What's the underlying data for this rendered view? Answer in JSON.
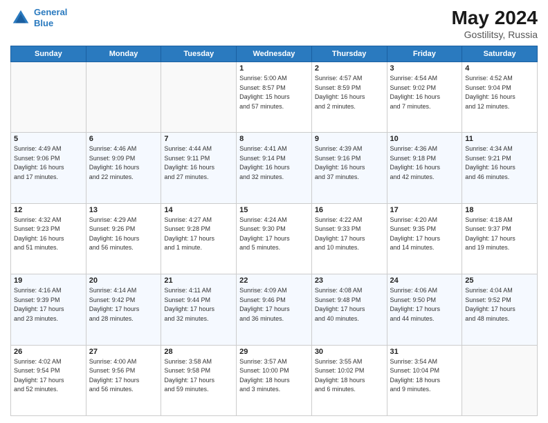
{
  "header": {
    "logo_line1": "General",
    "logo_line2": "Blue",
    "month": "May 2024",
    "location": "Gostilitsy, Russia"
  },
  "weekdays": [
    "Sunday",
    "Monday",
    "Tuesday",
    "Wednesday",
    "Thursday",
    "Friday",
    "Saturday"
  ],
  "weeks": [
    [
      {
        "day": "",
        "info": ""
      },
      {
        "day": "",
        "info": ""
      },
      {
        "day": "",
        "info": ""
      },
      {
        "day": "1",
        "info": "Sunrise: 5:00 AM\nSunset: 8:57 PM\nDaylight: 15 hours\nand 57 minutes."
      },
      {
        "day": "2",
        "info": "Sunrise: 4:57 AM\nSunset: 8:59 PM\nDaylight: 16 hours\nand 2 minutes."
      },
      {
        "day": "3",
        "info": "Sunrise: 4:54 AM\nSunset: 9:02 PM\nDaylight: 16 hours\nand 7 minutes."
      },
      {
        "day": "4",
        "info": "Sunrise: 4:52 AM\nSunset: 9:04 PM\nDaylight: 16 hours\nand 12 minutes."
      }
    ],
    [
      {
        "day": "5",
        "info": "Sunrise: 4:49 AM\nSunset: 9:06 PM\nDaylight: 16 hours\nand 17 minutes."
      },
      {
        "day": "6",
        "info": "Sunrise: 4:46 AM\nSunset: 9:09 PM\nDaylight: 16 hours\nand 22 minutes."
      },
      {
        "day": "7",
        "info": "Sunrise: 4:44 AM\nSunset: 9:11 PM\nDaylight: 16 hours\nand 27 minutes."
      },
      {
        "day": "8",
        "info": "Sunrise: 4:41 AM\nSunset: 9:14 PM\nDaylight: 16 hours\nand 32 minutes."
      },
      {
        "day": "9",
        "info": "Sunrise: 4:39 AM\nSunset: 9:16 PM\nDaylight: 16 hours\nand 37 minutes."
      },
      {
        "day": "10",
        "info": "Sunrise: 4:36 AM\nSunset: 9:18 PM\nDaylight: 16 hours\nand 42 minutes."
      },
      {
        "day": "11",
        "info": "Sunrise: 4:34 AM\nSunset: 9:21 PM\nDaylight: 16 hours\nand 46 minutes."
      }
    ],
    [
      {
        "day": "12",
        "info": "Sunrise: 4:32 AM\nSunset: 9:23 PM\nDaylight: 16 hours\nand 51 minutes."
      },
      {
        "day": "13",
        "info": "Sunrise: 4:29 AM\nSunset: 9:26 PM\nDaylight: 16 hours\nand 56 minutes."
      },
      {
        "day": "14",
        "info": "Sunrise: 4:27 AM\nSunset: 9:28 PM\nDaylight: 17 hours\nand 1 minute."
      },
      {
        "day": "15",
        "info": "Sunrise: 4:24 AM\nSunset: 9:30 PM\nDaylight: 17 hours\nand 5 minutes."
      },
      {
        "day": "16",
        "info": "Sunrise: 4:22 AM\nSunset: 9:33 PM\nDaylight: 17 hours\nand 10 minutes."
      },
      {
        "day": "17",
        "info": "Sunrise: 4:20 AM\nSunset: 9:35 PM\nDaylight: 17 hours\nand 14 minutes."
      },
      {
        "day": "18",
        "info": "Sunrise: 4:18 AM\nSunset: 9:37 PM\nDaylight: 17 hours\nand 19 minutes."
      }
    ],
    [
      {
        "day": "19",
        "info": "Sunrise: 4:16 AM\nSunset: 9:39 PM\nDaylight: 17 hours\nand 23 minutes."
      },
      {
        "day": "20",
        "info": "Sunrise: 4:14 AM\nSunset: 9:42 PM\nDaylight: 17 hours\nand 28 minutes."
      },
      {
        "day": "21",
        "info": "Sunrise: 4:11 AM\nSunset: 9:44 PM\nDaylight: 17 hours\nand 32 minutes."
      },
      {
        "day": "22",
        "info": "Sunrise: 4:09 AM\nSunset: 9:46 PM\nDaylight: 17 hours\nand 36 minutes."
      },
      {
        "day": "23",
        "info": "Sunrise: 4:08 AM\nSunset: 9:48 PM\nDaylight: 17 hours\nand 40 minutes."
      },
      {
        "day": "24",
        "info": "Sunrise: 4:06 AM\nSunset: 9:50 PM\nDaylight: 17 hours\nand 44 minutes."
      },
      {
        "day": "25",
        "info": "Sunrise: 4:04 AM\nSunset: 9:52 PM\nDaylight: 17 hours\nand 48 minutes."
      }
    ],
    [
      {
        "day": "26",
        "info": "Sunrise: 4:02 AM\nSunset: 9:54 PM\nDaylight: 17 hours\nand 52 minutes."
      },
      {
        "day": "27",
        "info": "Sunrise: 4:00 AM\nSunset: 9:56 PM\nDaylight: 17 hours\nand 56 minutes."
      },
      {
        "day": "28",
        "info": "Sunrise: 3:58 AM\nSunset: 9:58 PM\nDaylight: 17 hours\nand 59 minutes."
      },
      {
        "day": "29",
        "info": "Sunrise: 3:57 AM\nSunset: 10:00 PM\nDaylight: 18 hours\nand 3 minutes."
      },
      {
        "day": "30",
        "info": "Sunrise: 3:55 AM\nSunset: 10:02 PM\nDaylight: 18 hours\nand 6 minutes."
      },
      {
        "day": "31",
        "info": "Sunrise: 3:54 AM\nSunset: 10:04 PM\nDaylight: 18 hours\nand 9 minutes."
      },
      {
        "day": "",
        "info": ""
      }
    ]
  ]
}
